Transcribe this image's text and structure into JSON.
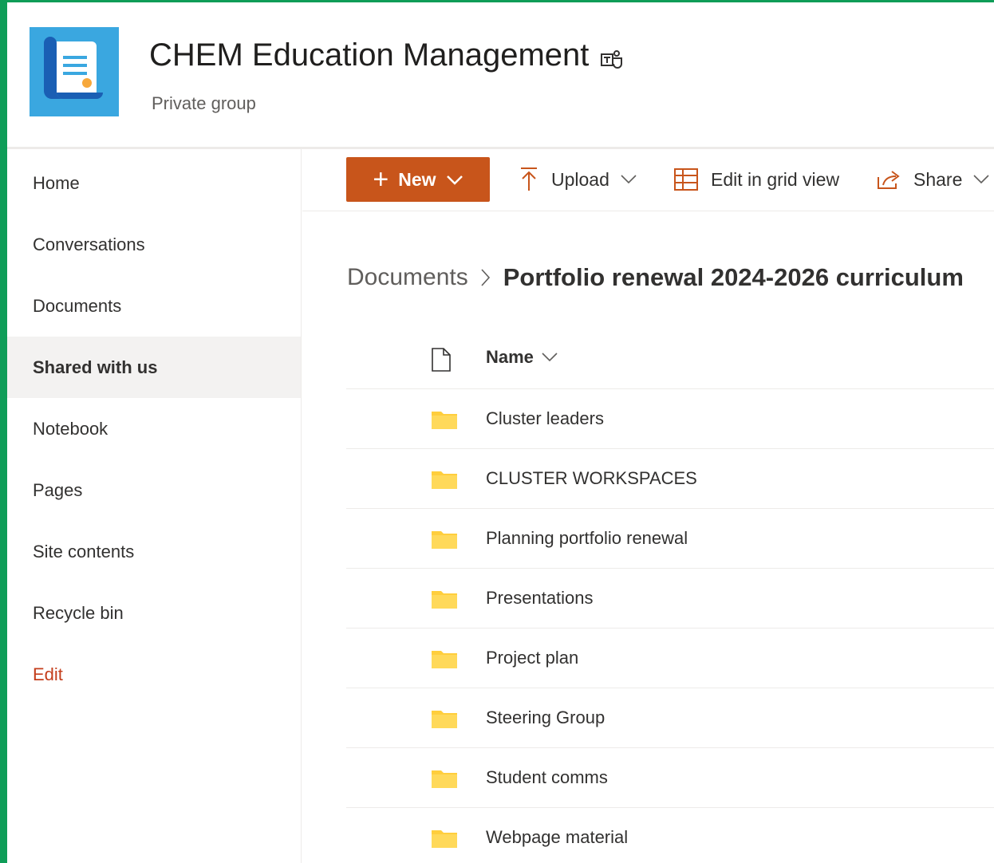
{
  "site": {
    "title": "CHEM Education Management",
    "subtitle": "Private group"
  },
  "nav": {
    "items": [
      {
        "label": "Home"
      },
      {
        "label": "Conversations"
      },
      {
        "label": "Documents"
      },
      {
        "label": "Shared with us",
        "selected": true
      },
      {
        "label": "Notebook"
      },
      {
        "label": "Pages"
      },
      {
        "label": "Site contents"
      },
      {
        "label": "Recycle bin"
      },
      {
        "label": "Edit"
      }
    ]
  },
  "toolbar": {
    "new_label": "New",
    "upload_label": "Upload",
    "grid_label": "Edit in grid view",
    "share_label": "Share"
  },
  "breadcrumb": {
    "root": "Documents",
    "current": "Portfolio renewal 2024-2026 curriculum"
  },
  "list": {
    "column_name": "Name",
    "rows": [
      {
        "name": "Cluster leaders"
      },
      {
        "name": "CLUSTER WORKSPACES"
      },
      {
        "name": "Planning portfolio renewal"
      },
      {
        "name": "Presentations"
      },
      {
        "name": "Project plan"
      },
      {
        "name": "Steering Group"
      },
      {
        "name": "Student comms"
      },
      {
        "name": "Webpage material"
      }
    ]
  },
  "colors": {
    "accent": "#c8551b",
    "frame": "#0f9d58",
    "logo_bg": "#3aa7e0",
    "folder": "#ffce3d",
    "edit_link": "#c43e1c"
  }
}
